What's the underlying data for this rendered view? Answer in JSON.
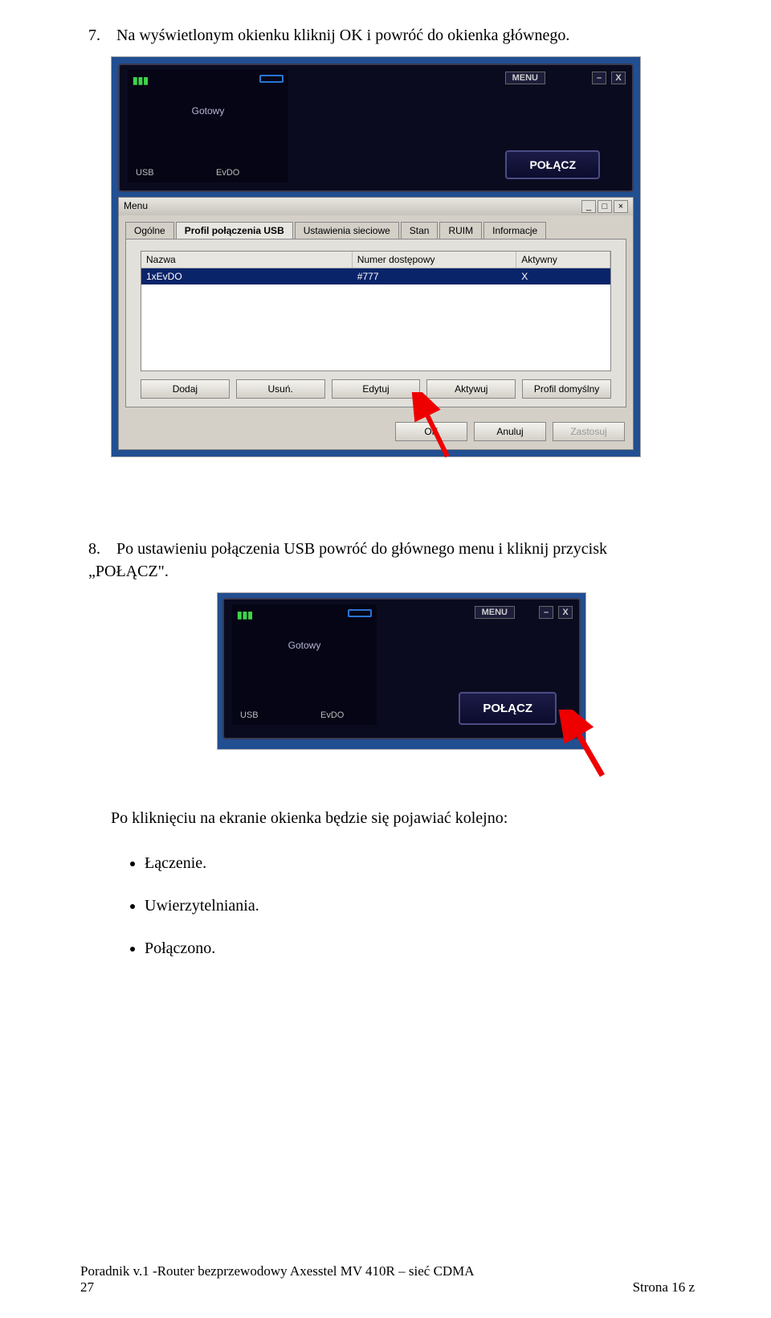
{
  "step7": {
    "num": "7.",
    "text": "Na wyświetlonym okienku kliknij OK i powróć do okienka głównego."
  },
  "shot1": {
    "menu": "MENU",
    "status": "Gotowy",
    "usb": "USB",
    "evdo": "EvDO",
    "connect": "POŁĄCZ",
    "title": "Menu",
    "tabs": [
      "Ogólne",
      "Profil połączenia USB",
      "Ustawienia sieciowe",
      "Stan",
      "RUIM",
      "Informacje"
    ],
    "columns": [
      "Nazwa",
      "Numer dostępowy",
      "Aktywny"
    ],
    "row": [
      "1xEvDO",
      "#777",
      "X"
    ],
    "rowbtns": [
      "Dodaj",
      "Usuń.",
      "Edytuj",
      "Aktywuj",
      "Profil domyślny"
    ],
    "actions": {
      "ok": "OK",
      "cancel": "Anuluj",
      "apply": "Zastosuj"
    }
  },
  "step8": {
    "num": "8.",
    "text": "Po ustawieniu połączenia USB powróć do głównego menu i kliknij przycisk „POŁĄCZ\"."
  },
  "shot2": {
    "menu": "MENU",
    "status": "Gotowy",
    "usb": "USB",
    "evdo": "EvDO",
    "connect": "POŁĄCZ"
  },
  "para": "Po kliknięciu na ekranie okienka będzie się pojawiać kolejno:",
  "bullets": [
    "Łączenie.",
    "Uwierzytelniania.",
    "Połączono."
  ],
  "footer": {
    "left": "Poradnik v.1 -Router bezprzewodowy Axesstel MV 410R – sieć CDMA\n27",
    "right": "Strona 16 z"
  }
}
